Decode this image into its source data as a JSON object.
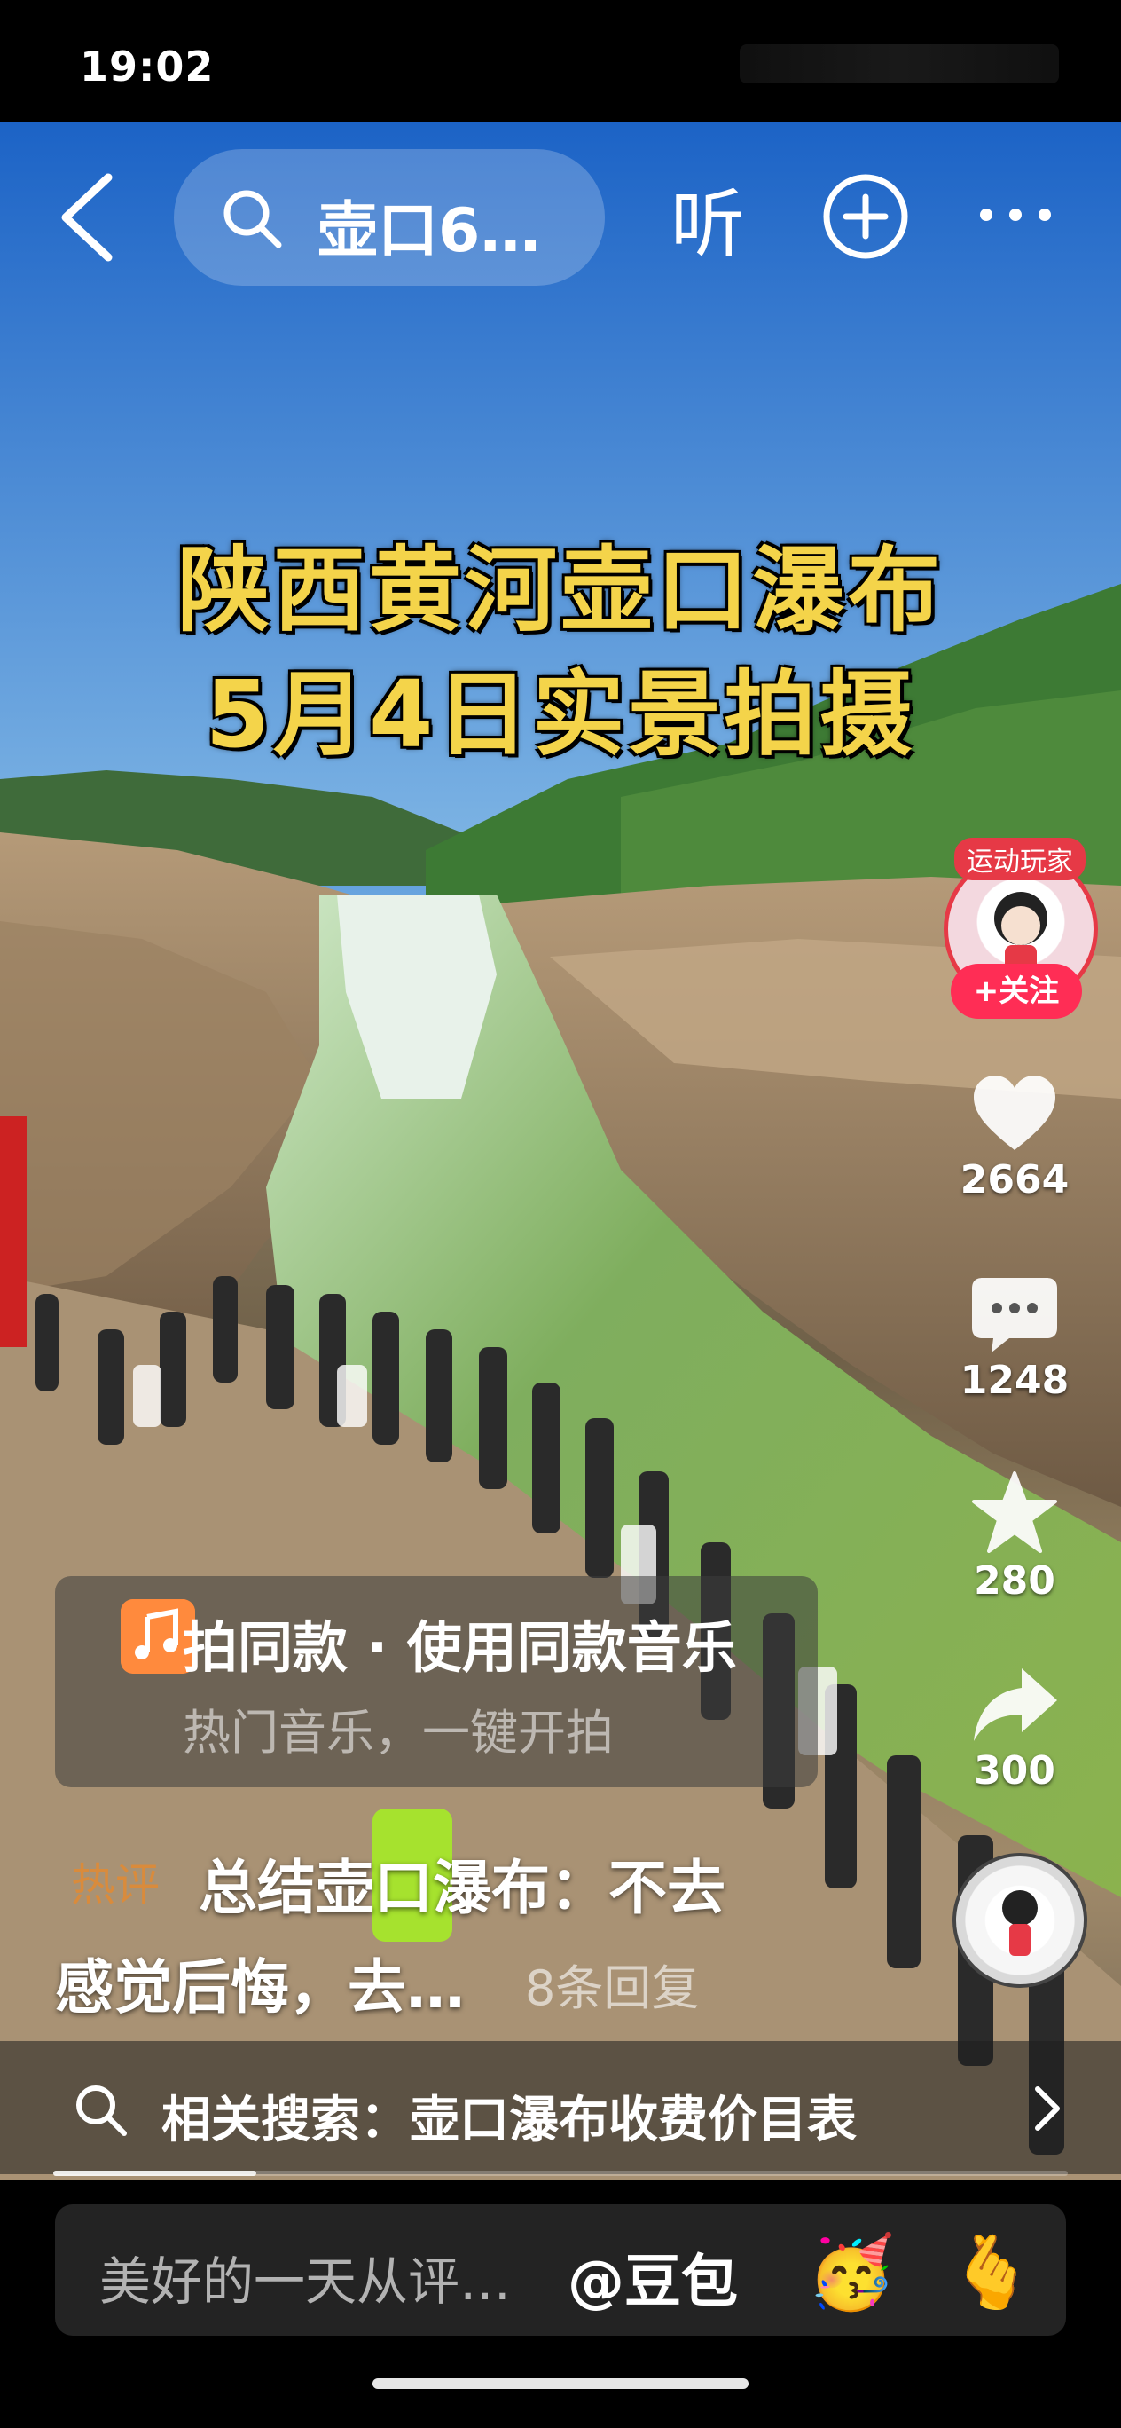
{
  "status": {
    "time": "19:02"
  },
  "nav": {
    "search_query": "壶口6…",
    "listen_label": "听"
  },
  "video": {
    "title_line1": "陕西黄河壶口瀑布",
    "title_line2": "5月4日实景拍摄"
  },
  "creator": {
    "avatar_tag": "运动玩家",
    "follow_label": "+关注"
  },
  "actions": {
    "likes": "2664",
    "comments": "1248",
    "favorites": "280",
    "shares": "300"
  },
  "music": {
    "title": "拍同款 · 使用同款音乐",
    "subtitle": "热门音乐，一键开拍"
  },
  "hot_comment": {
    "tag": "热评",
    "text_line1": "总结壶口瀑布：不去",
    "text_line2": "感觉后悔，去…",
    "replies": "8条回复"
  },
  "related_search": {
    "text": "相关搜索：壶口瀑布收费价目表"
  },
  "comment_input": {
    "placeholder": "美好的一天从评…",
    "mention": "@豆包",
    "emoji": "🥳",
    "gesture": "🫰"
  },
  "video_progress": 0.2,
  "colors": {
    "follow": "#ff2d55",
    "title_yellow": "#f4d44a",
    "music_icon": "#ff8a3d",
    "hot_tag": "#d98b3c"
  },
  "icons": [
    "back-icon",
    "search-icon",
    "plus-circle-icon",
    "more-icon",
    "heart-icon",
    "comment-icon",
    "star-icon",
    "share-icon",
    "music-note-icon",
    "chevron-right-icon"
  ]
}
